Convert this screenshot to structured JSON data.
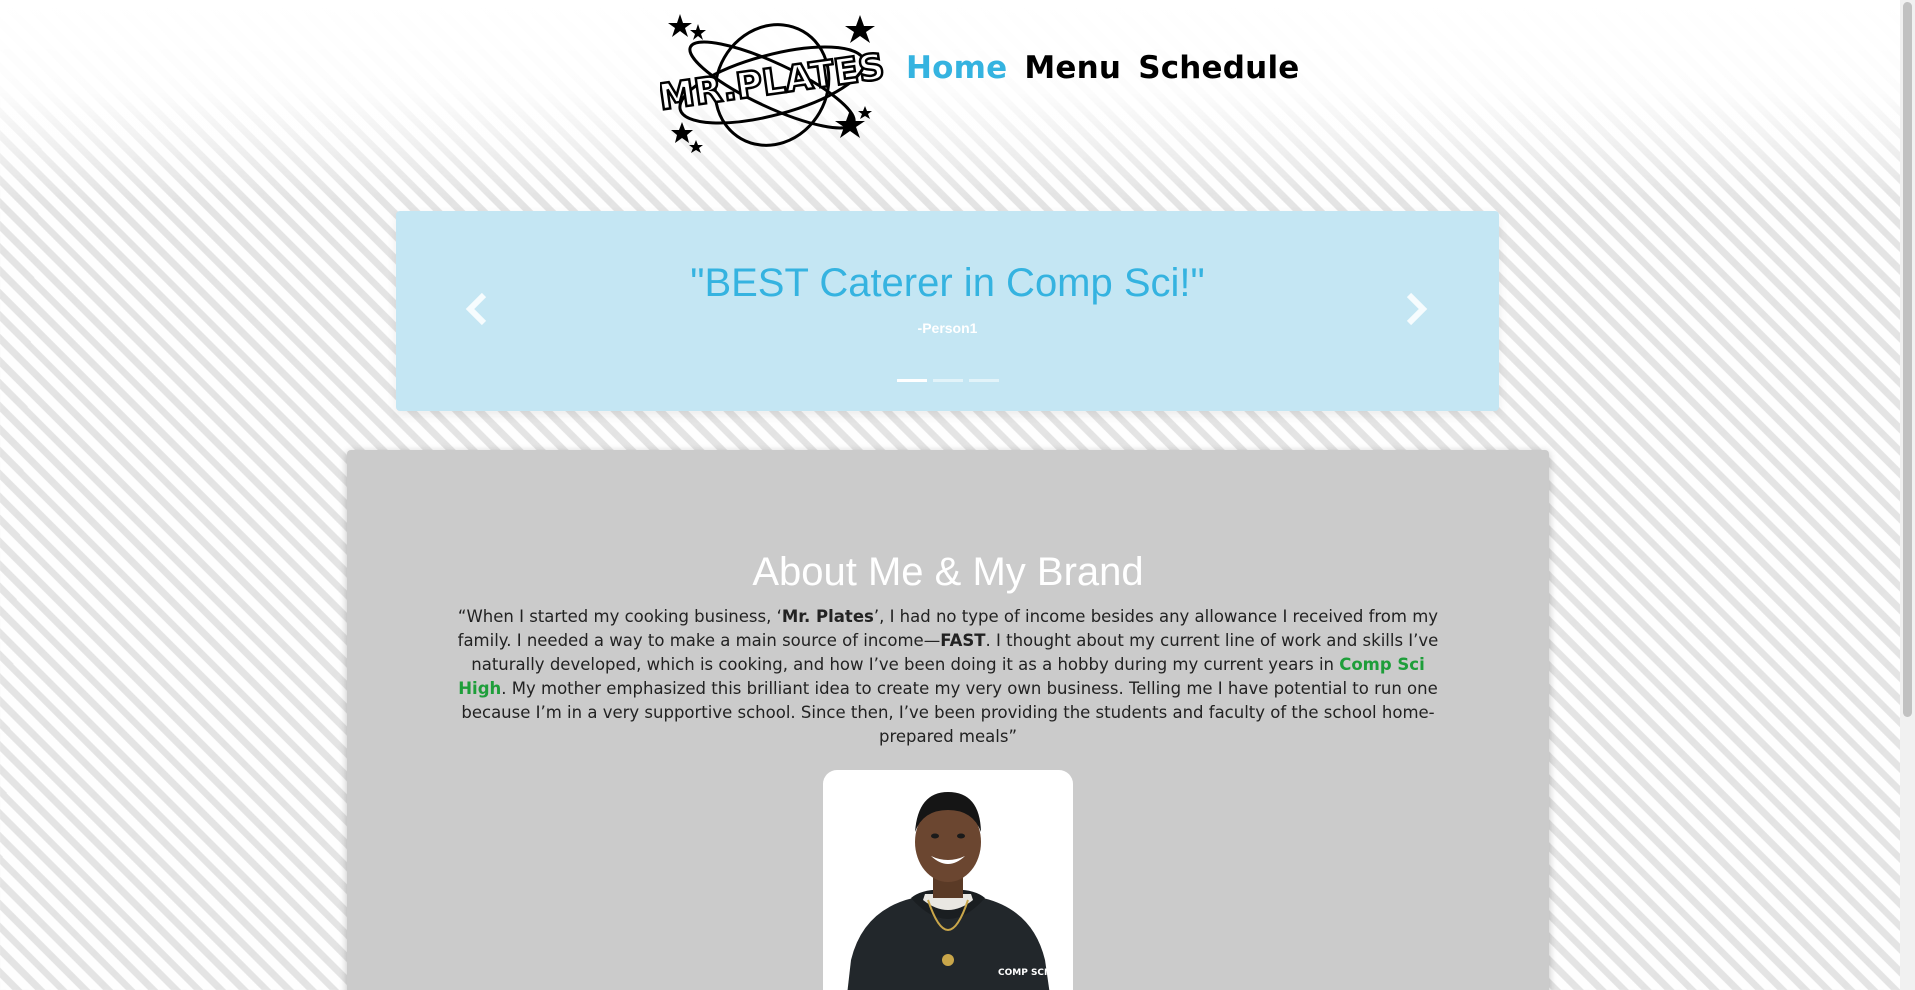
{
  "header": {
    "logo_text": "MR.PLATES",
    "nav": [
      {
        "label": "Home",
        "active": true
      },
      {
        "label": "Menu",
        "active": false
      },
      {
        "label": "Schedule",
        "active": false
      }
    ]
  },
  "carousel": {
    "quote": "\"BEST Caterer in Comp Sci!\"",
    "author": "-Person1",
    "prev_label": "Previous",
    "next_label": "Next",
    "slide_count": 3,
    "active_index": 0
  },
  "about": {
    "title": "About Me & My Brand",
    "text": {
      "t1": "“When I started my cooking business, ‘",
      "brand": "Mr. Plates",
      "t2": "’, I had no type of income besides any allowance I received from my family. I needed a way to make a main source of income—",
      "fast": "FAST",
      "t3": ". I thought about my current line of work and skills I’ve naturally developed, which is cooking, and how I’ve been doing it as a hobby during my current years in ",
      "school": "Comp Sci High",
      "t4": ". My mother emphasized this brilliant idea to create my very own business. Telling me I have potential to run one because I’m in a very supportive school. Since then, I’ve been providing the students and faculty of the school home-prepared meals”"
    },
    "hoodie_text": "COMP SCI HIGH"
  },
  "colors": {
    "accent": "#35b3e0",
    "carousel_bg": "#c4e6f3",
    "card_bg": "#cbcbcb",
    "school_green": "#1e9e3a"
  }
}
